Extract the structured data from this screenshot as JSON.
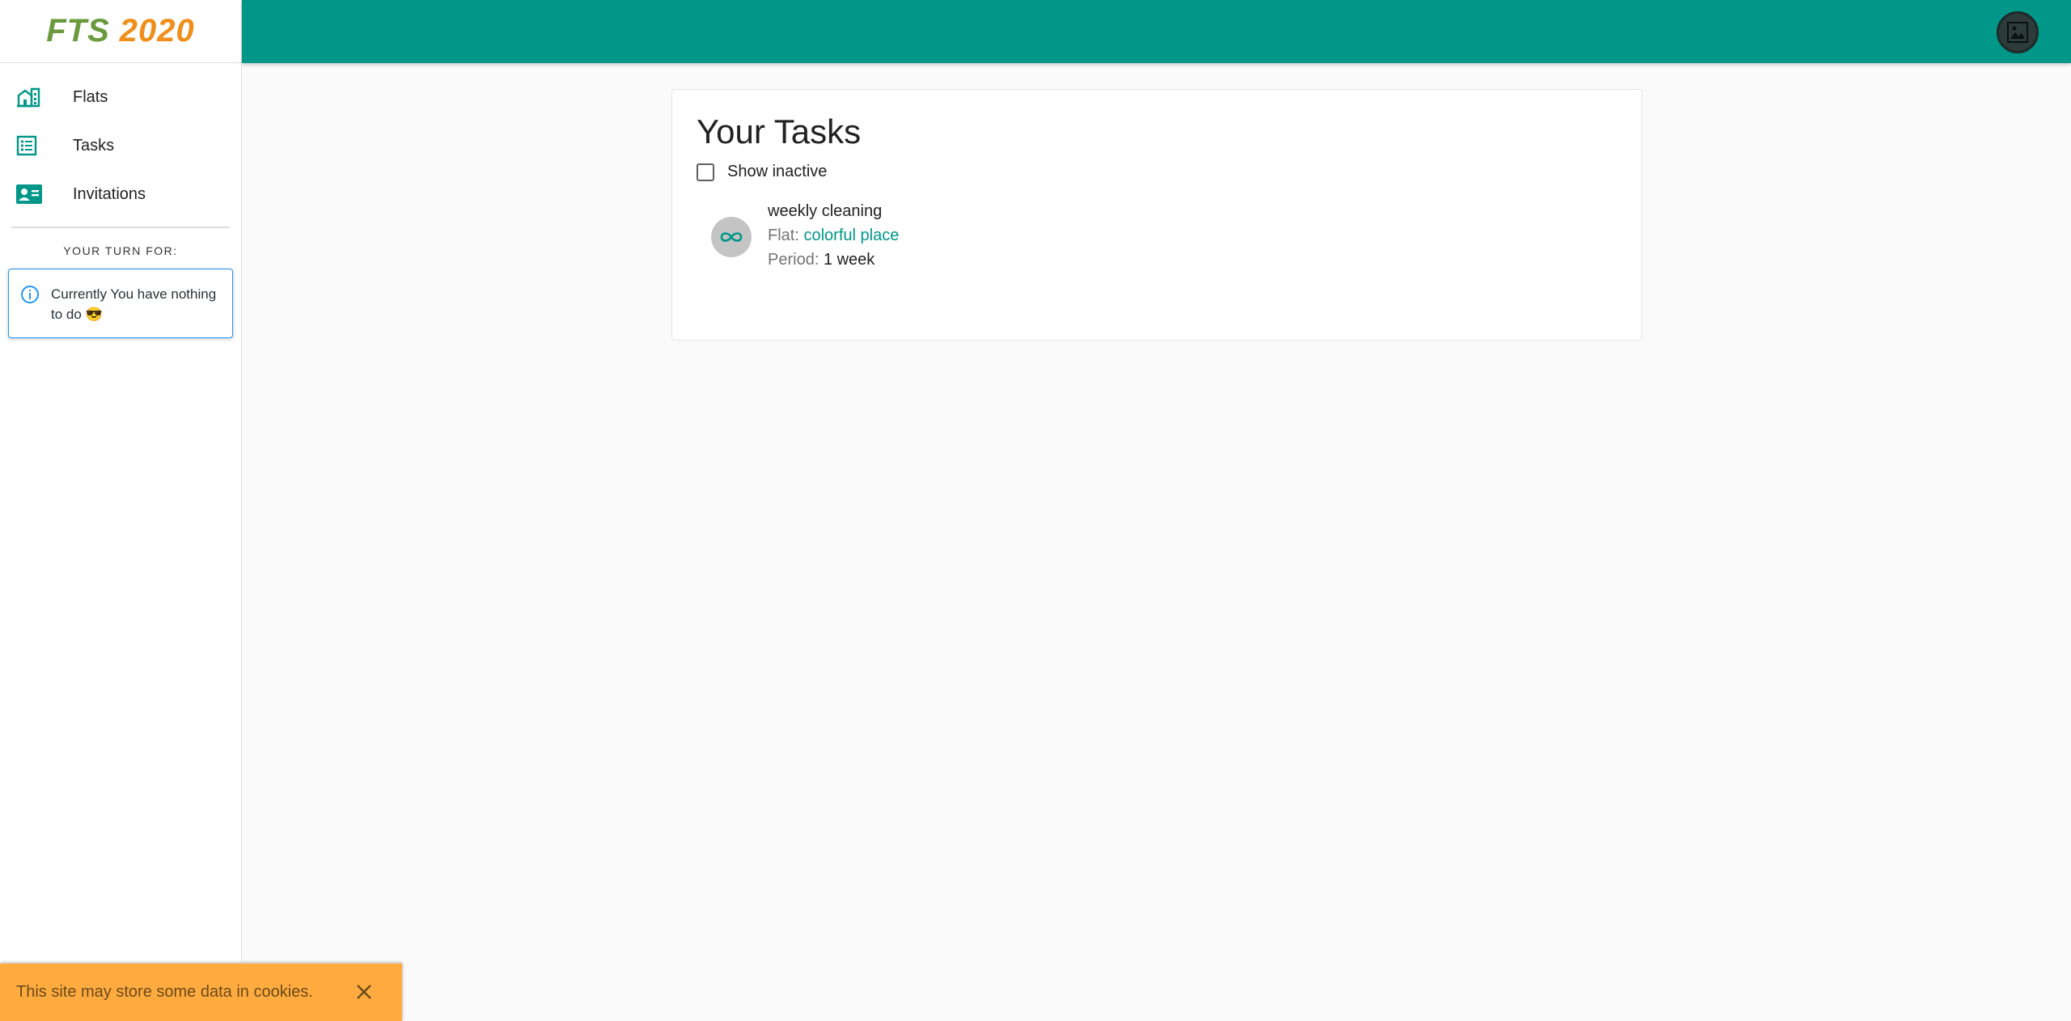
{
  "app": {
    "logo_part1": "FTS",
    "logo_part2": "2020",
    "brand_primary": "#009688",
    "brand_accent": "#ffab40"
  },
  "sidebar": {
    "items": [
      {
        "label": "Flats",
        "icon": "apartment-icon"
      },
      {
        "label": "Tasks",
        "icon": "list-icon"
      },
      {
        "label": "Invitations",
        "icon": "contact-card-icon"
      }
    ],
    "turn_heading": "YOUR TURN FOR:",
    "info_message": "Currently You have nothing to do 😎"
  },
  "main": {
    "title": "Your Tasks",
    "show_inactive_label": "Show inactive",
    "show_inactive_checked": false,
    "tasks": [
      {
        "title": "weekly cleaning",
        "flat_label": "Flat:",
        "flat_value": "colorful place",
        "period_label": "Period:",
        "period_value": "1 week",
        "icon": "infinity-icon"
      }
    ]
  },
  "cookie_banner": {
    "text": "This site may store some data in cookies."
  }
}
